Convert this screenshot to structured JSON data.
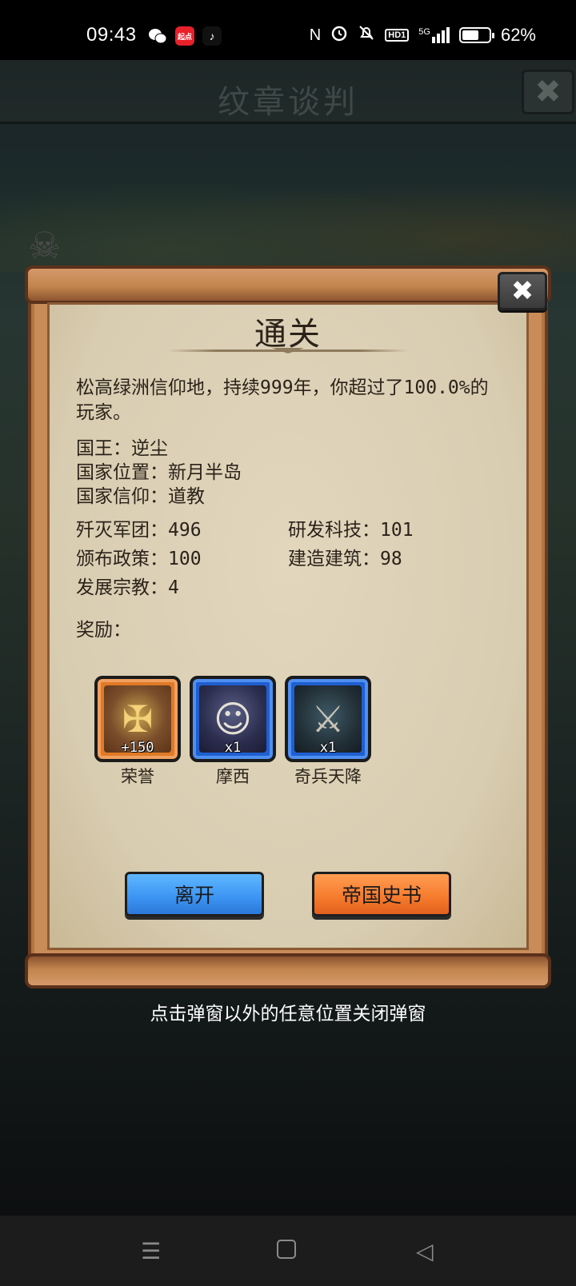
{
  "status_bar": {
    "time": "09:43",
    "app_icons": [
      "wechat-icon",
      "qidian-icon",
      "tiktok-icon"
    ],
    "qidian_label": "起点",
    "tiktok_glyph": "♪",
    "wechat_glyph": "●●",
    "nfc_glyph": "N",
    "alarm_glyph": "⏰",
    "mute_glyph": "🔕",
    "hd_label": "HD1",
    "signal_label": "5G",
    "battery_percent": "62%",
    "battery_level": 0.62
  },
  "background": {
    "screen_title": "纹章谈判",
    "close_glyph": "✖",
    "flag_glyph": "☠"
  },
  "dialog": {
    "close_glyph": "✖",
    "title": "通关",
    "summary": "松高绿洲信仰地，持续999年，你超过了100.0%的玩家。",
    "king": "国王：逆尘",
    "location": "国家位置：新月半岛",
    "faith": "国家信仰：道教",
    "stats": {
      "armies_destroyed": "歼灭军团：496",
      "tech_researched": "研发科技：101",
      "policies_issued": "颁布政策：100",
      "buildings_built": "建造建筑：98",
      "religions_developed": "发展宗教：4"
    },
    "rewards_label": "奖励：",
    "rewards": [
      {
        "name": "荣誉",
        "count": "+150",
        "glyph": "✠"
      },
      {
        "name": "摩西",
        "count": "x1",
        "glyph": "☺"
      },
      {
        "name": "奇兵天降",
        "count": "x1",
        "glyph": "⚔"
      }
    ],
    "leave_button": "离开",
    "history_button": "帝国史书"
  },
  "hint": "点击弹窗以外的任意位置关闭弹窗",
  "nav": {
    "menu_glyph": "☰",
    "back_glyph": "◁"
  }
}
